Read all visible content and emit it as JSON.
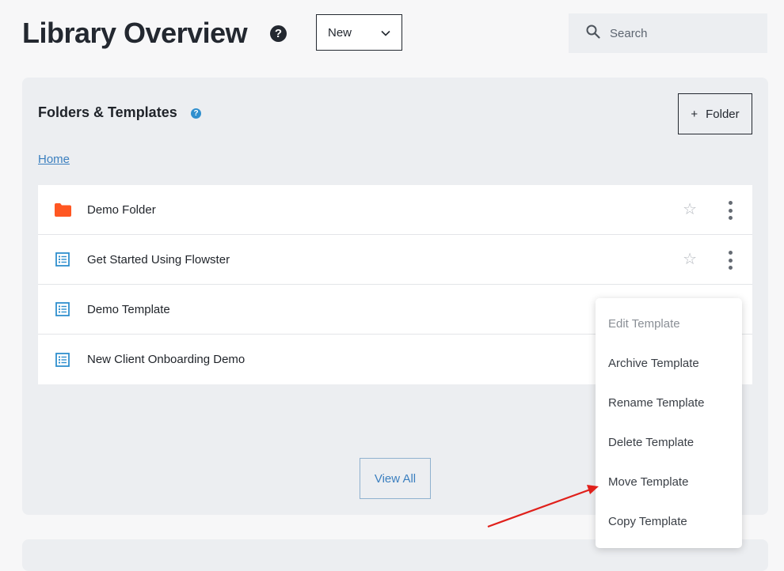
{
  "header": {
    "title": "Library Overview",
    "help_icon_glyph": "?",
    "new_select_value": "New",
    "search_placeholder": "Search"
  },
  "panel": {
    "title": "Folders & Templates",
    "info_icon_glyph": "?",
    "add_folder_label": "Folder",
    "add_folder_icon": "+",
    "breadcrumb": "Home",
    "view_all_label": "View All"
  },
  "items": [
    {
      "label": "Demo Folder",
      "type": "folder",
      "icon": "folder-icon"
    },
    {
      "label": "Get Started Using Flowster",
      "type": "template",
      "icon": "template-list-icon"
    },
    {
      "label": "Demo Template",
      "type": "template",
      "icon": "template-list-icon"
    },
    {
      "label": "New Client Onboarding Demo",
      "type": "template",
      "icon": "template-list-icon"
    }
  ],
  "context_menu": {
    "items": [
      {
        "label": "Edit Template",
        "disabled": true
      },
      {
        "label": "Archive Template",
        "disabled": false
      },
      {
        "label": "Rename Template",
        "disabled": false
      },
      {
        "label": "Delete Template",
        "disabled": false
      },
      {
        "label": "Move Template",
        "disabled": false
      },
      {
        "label": "Copy Template",
        "disabled": false
      }
    ]
  },
  "colors": {
    "folder": "#ff5722",
    "template_icon": "#2f8fce",
    "link": "#3b7fbf",
    "annotation_arrow": "#e0201b"
  }
}
